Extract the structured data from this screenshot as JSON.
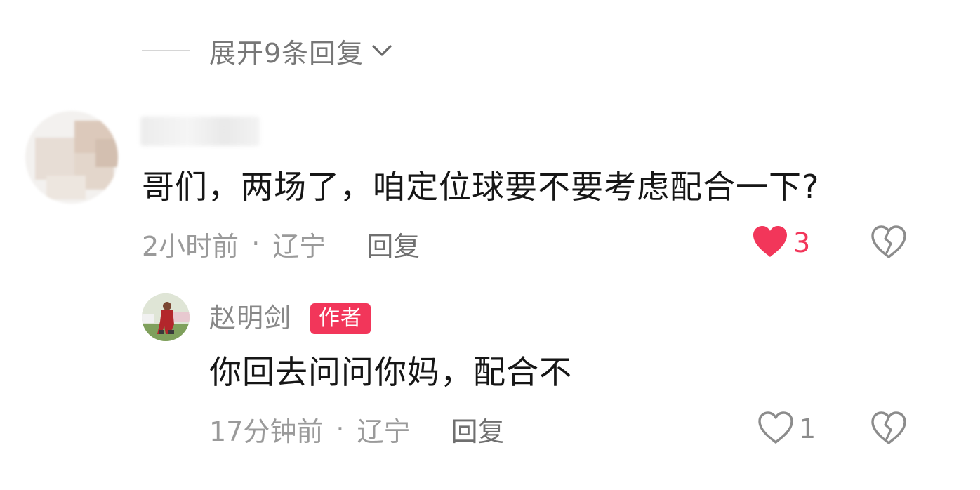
{
  "expand": {
    "label": "展开9条回复",
    "icon": "chevron-down-icon"
  },
  "comment": {
    "text": "哥们，两场了，咱定位球要不要考虑配合一下?",
    "time": "2小时前",
    "separator": "·",
    "location": "辽宁",
    "reply_label": "回复",
    "likes": "3",
    "liked": true
  },
  "reply": {
    "author": "赵明剑",
    "badge": "作者",
    "text": "你回去问问你妈，配合不",
    "time": "17分钟前",
    "separator": "·",
    "location": "辽宁",
    "reply_label": "回复",
    "likes": "1",
    "liked": false
  },
  "colors": {
    "like_active": "#f2365a",
    "badge_bg": "#f2365a",
    "meta_text": "#9a9a9a",
    "icon_gray": "#a0a0a0"
  }
}
